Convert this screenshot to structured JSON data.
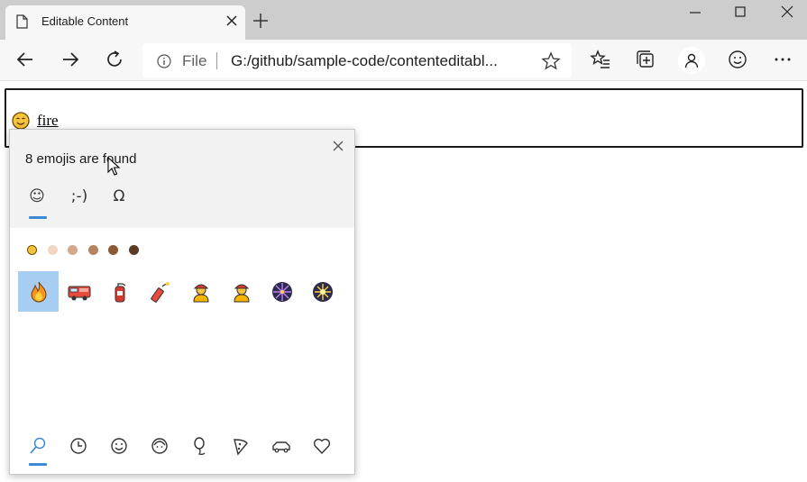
{
  "browser": {
    "tab_title": "Editable Content",
    "address_scheme": "File",
    "address_url": "G:/github/sample-code/contenteditabl..."
  },
  "editor": {
    "text": "fire",
    "emoji_icon": "smiling-face-icon"
  },
  "emoji_panel": {
    "title": "8 emojis are found",
    "category_tabs": [
      {
        "label": "☺",
        "icon": "smiley-icon",
        "selected": true
      },
      {
        "label": ";-)",
        "icon": "kaomoji-icon",
        "selected": false
      },
      {
        "label": "Ω",
        "icon": "symbols-icon",
        "selected": false
      }
    ],
    "skin_tones": [
      "#f8c33c",
      "#f2d6c2",
      "#d4a98b",
      "#b48460",
      "#8a5a36",
      "#5c3b22"
    ],
    "results": [
      {
        "name": "fire",
        "icon": "fire-icon",
        "selected": true
      },
      {
        "name": "fire engine",
        "icon": "fire-engine-icon",
        "selected": false
      },
      {
        "name": "fire extinguisher",
        "icon": "fire-extinguisher-icon",
        "selected": false
      },
      {
        "name": "firecracker",
        "icon": "firecracker-icon",
        "selected": false
      },
      {
        "name": "firefighter",
        "icon": "firefighter-icon",
        "selected": false
      },
      {
        "name": "firefighter",
        "icon": "firefighter-icon",
        "selected": false
      },
      {
        "name": "fireworks",
        "icon": "fireworks-icon",
        "selected": false
      },
      {
        "name": "sparkler",
        "icon": "sparkler-icon",
        "selected": false
      }
    ],
    "bottom_icons": [
      "search-icon",
      "recent-icon",
      "smiley-face-icon",
      "people-icon",
      "balloon-icon",
      "food-icon",
      "travel-icon",
      "heart-icon"
    ]
  },
  "colors": {
    "accent": "#3a8ad8",
    "selection": "#a6cdf2"
  }
}
